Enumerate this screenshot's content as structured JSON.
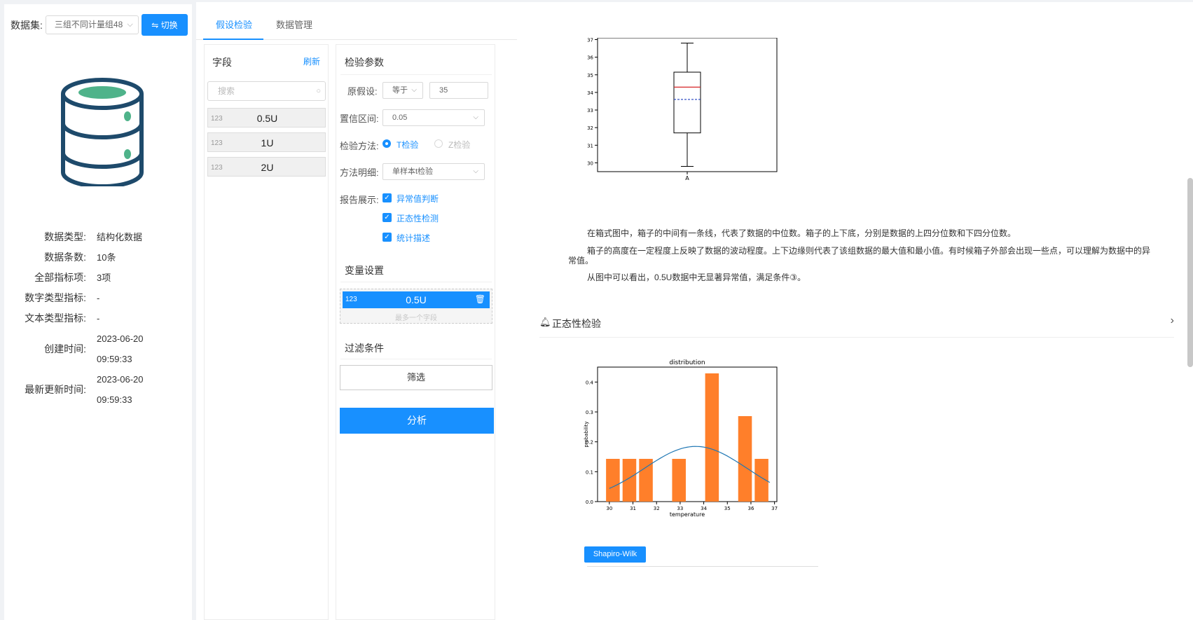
{
  "dataset": {
    "label": "数据集:",
    "selected": "三组不同计量组48",
    "switch_btn": "⇋ 切换"
  },
  "info": [
    {
      "k": "数据类型:",
      "v": "结构化数据"
    },
    {
      "k": "数据条数:",
      "v": "10条"
    },
    {
      "k": "全部指标项:",
      "v": "3项"
    },
    {
      "k": "数字类型指标:",
      "v": "-"
    },
    {
      "k": "文本类型指标:",
      "v": "-"
    },
    {
      "k": "创建时间:",
      "v1": "2023-06-20",
      "v2": "09:59:33"
    },
    {
      "k": "最新更新时间:",
      "v1": "2023-06-20",
      "v2": "09:59:33"
    }
  ],
  "tabs": {
    "t1": "假设检验",
    "t2": "数据管理"
  },
  "fields": {
    "title": "字段",
    "refresh": "刷新",
    "search_placeholder": "搜索",
    "items": [
      {
        "type": "123",
        "name": "0.5U"
      },
      {
        "type": "123",
        "name": "1U"
      },
      {
        "type": "123",
        "name": "2U"
      }
    ]
  },
  "params": {
    "title": "检验参数",
    "null_hyp_label": "原假设:",
    "null_hyp_op": "等于",
    "null_hyp_value": "35",
    "conf_label": "置信区间:",
    "conf_value": "0.05",
    "method_label": "检验方法:",
    "method_t": "T检验",
    "method_z": "Z检验",
    "detail_label": "方法明细:",
    "detail_value": "单样本t检验",
    "report_label": "报告展示:",
    "report_opts": [
      "异常值判断",
      "正态性检测",
      "统计描述"
    ],
    "var_title": "变量设置",
    "var_field_type": "123",
    "var_field_name": "0.5U",
    "var_hint": "最多一个字段",
    "filter_title": "过滤条件",
    "filter_btn": "筛选",
    "analyze_btn": "分析"
  },
  "report": {
    "p1": "在箱式图中，箱子的中间有一条线，代表了数据的中位数。箱子的上下底，分别是数据的上四分位数和下四分位数。",
    "p2a": "箱子的高度在一定程度上反映了数据的波动程度。上下边缘则代表了该组数据的最大值和最小值。有时候箱子外部会出现一些点，可以理解为数据中的异",
    "p2b": "常值。",
    "p3": "从图中可以看出，0.5U数据中无显著异常值，满足条件③。",
    "section_title": "正态性检验",
    "sw_btn": "Shapiro-Wilk"
  },
  "chart_data": [
    {
      "type": "box",
      "yticks": [
        "30",
        "31",
        "32",
        "33",
        "34",
        "35",
        "36",
        "37"
      ],
      "xticks": [
        "A"
      ],
      "ylim": [
        29.5,
        37.1
      ],
      "min": 29.8,
      "q1": 31.7,
      "median": 34.3,
      "mean": 33.6,
      "q3": 35.15,
      "max": 36.8
    },
    {
      "type": "bar",
      "title": "distribution",
      "xlabel": "temperature",
      "ylabel": "probability",
      "xticks": [
        "30",
        "31",
        "32",
        "33",
        "34",
        "35",
        "36",
        "37"
      ],
      "yticks": [
        "0.0",
        "0.1",
        "0.2",
        "0.3",
        "0.4"
      ],
      "xlim": [
        29.5,
        37.1
      ],
      "ylim": [
        0,
        0.45
      ],
      "bars": [
        {
          "x": 30.15,
          "value": 0.143
        },
        {
          "x": 30.85,
          "value": 0.143
        },
        {
          "x": 31.55,
          "value": 0.143
        },
        {
          "x": 32.95,
          "value": 0.143
        },
        {
          "x": 34.35,
          "value": 0.429
        },
        {
          "x": 35.75,
          "value": 0.286
        },
        {
          "x": 36.45,
          "value": 0.143
        }
      ],
      "bar_width": 0.58,
      "curve": {
        "mean": 33.66,
        "sd": 2.16
      }
    }
  ]
}
